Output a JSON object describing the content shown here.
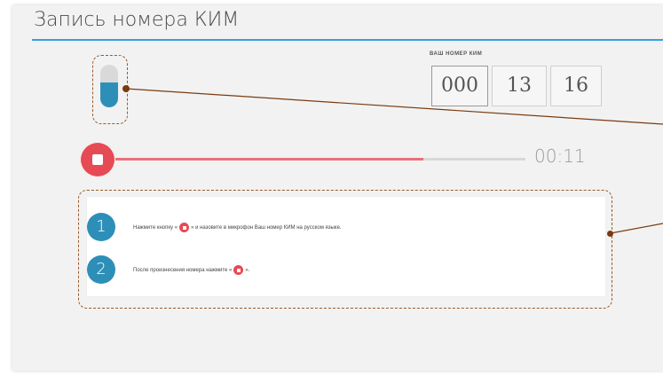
{
  "title": "Запись номера КИМ",
  "kim": {
    "label": "ВАШ НОМЕР КИМ",
    "parts": [
      "000",
      "13",
      "16"
    ]
  },
  "recorder": {
    "time": "00:11",
    "progress": 0.75
  },
  "instructions": [
    {
      "num": "1",
      "before": "Нажмите кнопку «",
      "after": "» и назовите в микрофон Ваш номер КИМ на русском языке."
    },
    {
      "num": "2",
      "before": "После произнесения номера нажмите «",
      "after": "»."
    }
  ],
  "colors": {
    "accent_blue": "#2d8fb8",
    "title_underline": "#3b9fd8",
    "record_red": "#e64a55",
    "annotation_brown": "#7a3b10"
  },
  "icons": {
    "microphone": "microphone-icon",
    "stop": "stop-icon"
  }
}
